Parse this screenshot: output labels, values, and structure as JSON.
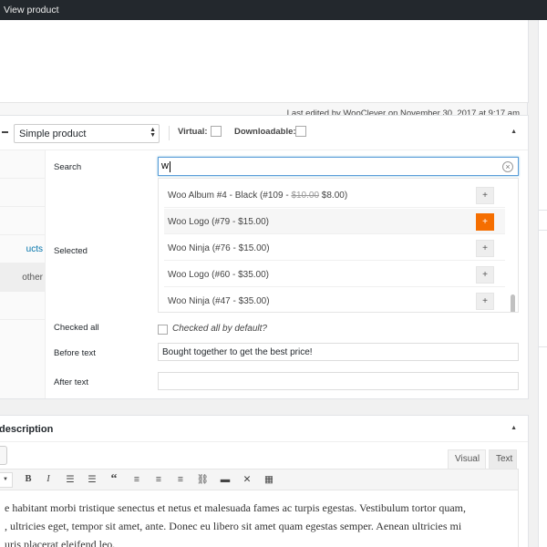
{
  "topbar": {
    "view_product": "View product"
  },
  "editor": {
    "last_edited": "Last edited by WooClever on November 30, 2017 at 9:17 am"
  },
  "product_data": {
    "product_type": "Simple product",
    "virtual_label": "Virtual:",
    "virtual_checked": false,
    "downloadable_label": "Downloadable:",
    "downloadable_checked": false,
    "tabs": [
      {
        "label": ""
      },
      {
        "label": ""
      },
      {
        "label": ""
      },
      {
        "label": "ucts"
      },
      {
        "label": "other"
      },
      {
        "label": ""
      }
    ],
    "search_label": "Search",
    "search_value": "w",
    "selected_label": "Selected",
    "results": [
      {
        "name": "Woo Album #4 - Black (#109 - ",
        "old_price": "$10.00",
        "price": " $8.00)",
        "add": "+"
      },
      {
        "name": "Woo Logo (#79 - $15.00)",
        "old_price": "",
        "price": "",
        "add": "+"
      },
      {
        "name": "Woo Ninja (#76 - $15.00)",
        "old_price": "",
        "price": "",
        "add": "+"
      },
      {
        "name": "Woo Logo (#60 - $35.00)",
        "old_price": "",
        "price": "",
        "add": "+"
      },
      {
        "name": "Woo Ninja (#47 - $35.00)",
        "old_price": "",
        "price": "",
        "add": "+"
      }
    ],
    "checked_all_label": "Checked all",
    "checked_all_text": "Checked all by default?",
    "before_text_label": "Before text",
    "before_text_value": "Bought together to get the best price!",
    "after_text_label": "After text",
    "after_text_value": ""
  },
  "description": {
    "title": "description",
    "visual_tab": "Visual",
    "text_tab": "Text",
    "line1": "e habitant morbi tristique senectus et netus et malesuada fames ac turpis egestas. Vestibulum tortor quam,",
    "line2": ", ultricies eget, tempor sit amet, ante. Donec eu libero sit amet quam egestas semper. Aenean ultricies mi",
    "line3": "uris placerat eleifend leo."
  },
  "colors": {
    "accent_orange": "#f56e00",
    "link_blue": "#0073aa",
    "topbar": "#23282d",
    "focus_blue": "#5b9dd9"
  },
  "icons": [
    "clear-icon",
    "collapse-arrow-icon",
    "add-icon",
    "bold-icon",
    "italic-icon",
    "bullet-list-icon",
    "numbered-list-icon",
    "blockquote-icon",
    "align-left-icon",
    "align-center-icon",
    "align-right-icon",
    "link-icon",
    "read-more-icon",
    "fullscreen-icon",
    "toolbar-toggle-icon"
  ]
}
